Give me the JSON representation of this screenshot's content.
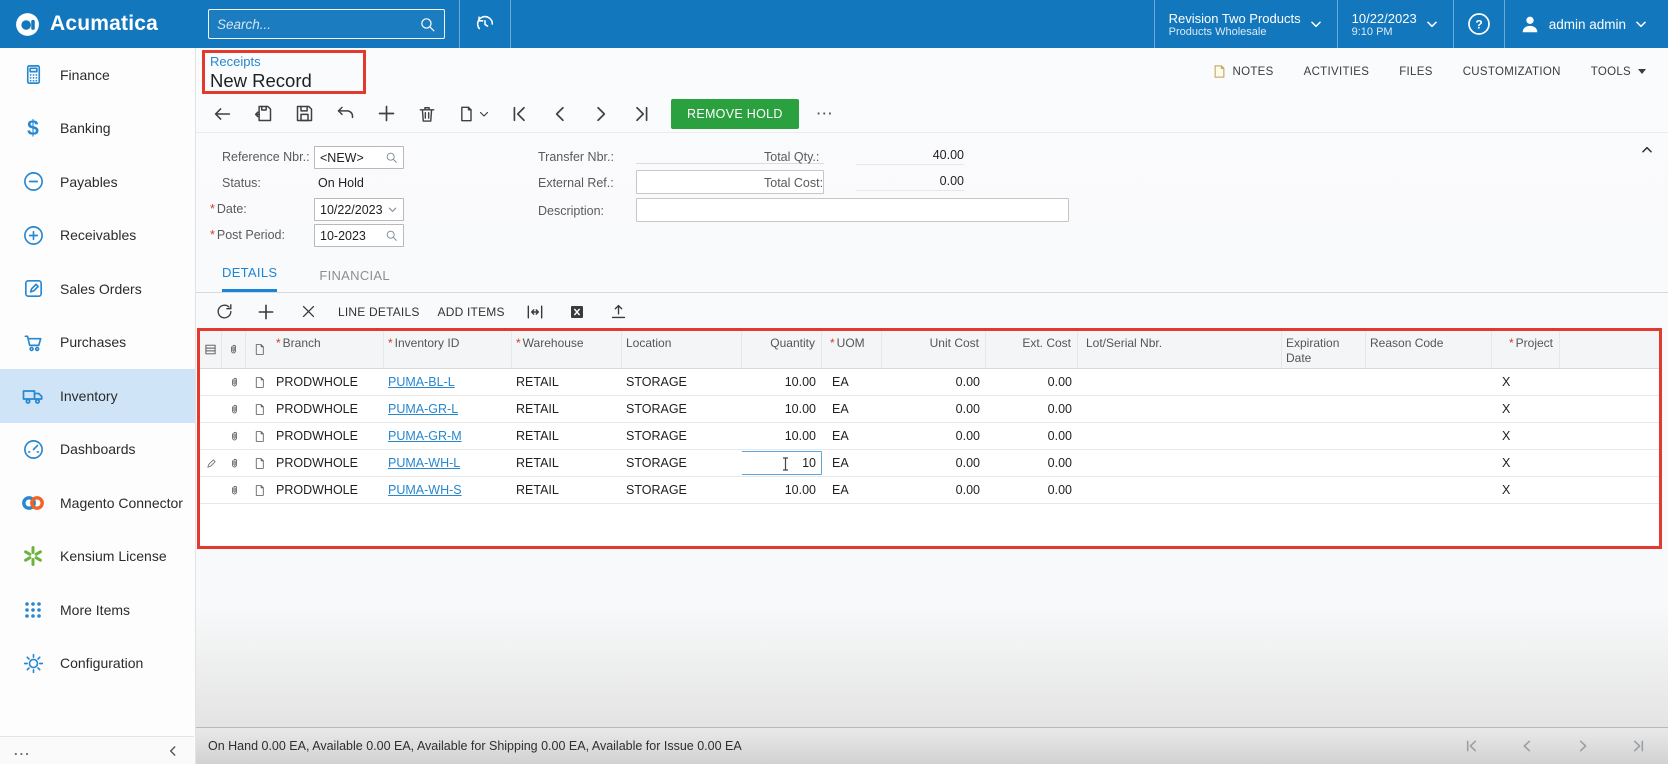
{
  "topbar": {
    "brand": "Acumatica",
    "search_placeholder": "Search...",
    "company_name": "Revision Two Products",
    "company_branch": "Products Wholesale",
    "date": "10/22/2023",
    "time": "9:10 PM",
    "user_name": "admin admin"
  },
  "header_links": {
    "notes": "NOTES",
    "activities": "ACTIVITIES",
    "files": "FILES",
    "customization": "CUSTOMIZATION",
    "tools": "TOOLS"
  },
  "breadcrumb": {
    "parent": "Receipts",
    "title": "New Record"
  },
  "toolbar": {
    "remove_hold_label": "REMOVE HOLD",
    "ellipsis": "⋯"
  },
  "sidebar": {
    "items": [
      {
        "label": "Finance"
      },
      {
        "label": "Banking"
      },
      {
        "label": "Payables"
      },
      {
        "label": "Receivables"
      },
      {
        "label": "Sales Orders"
      },
      {
        "label": "Purchases"
      },
      {
        "label": "Inventory"
      },
      {
        "label": "Dashboards"
      },
      {
        "label": "Magento Connector"
      },
      {
        "label": "Kensium License"
      },
      {
        "label": "More Items"
      },
      {
        "label": "Configuration"
      }
    ],
    "footer_dots": "...",
    "banking_glyph": "$"
  },
  "form": {
    "required_marker": "*",
    "reference_label": "Reference Nbr.:",
    "reference_value": "<NEW>",
    "status_label": "Status:",
    "status_value": "On Hold",
    "date_label": "Date:",
    "date_value": "10/22/2023",
    "post_period_label": "Post Period:",
    "post_period_value": "10-2023",
    "transfer_label": "Transfer Nbr.:",
    "external_ref_label": "External Ref.:",
    "description_label": "Description:",
    "total_qty_label": "Total Qty.:",
    "total_qty_value": "40.00",
    "total_cost_label": "Total Cost:",
    "total_cost_value": "0.00"
  },
  "tabs": {
    "details": "DETAILS",
    "financial": "FINANCIAL"
  },
  "grid_toolbar": {
    "line_details_label": "LINE DETAILS",
    "add_items_label": "ADD ITEMS"
  },
  "grid": {
    "required_marker": "*",
    "columns": {
      "branch": "Branch",
      "inventory_id": "Inventory ID",
      "warehouse": "Warehouse",
      "location": "Location",
      "quantity": "Quantity",
      "uom": "UOM",
      "unit_cost": "Unit Cost",
      "ext_cost": "Ext. Cost",
      "lot_serial": "Lot/Serial Nbr.",
      "expiration": "Expiration Date",
      "reason_code": "Reason Code",
      "project": "Project"
    },
    "rows": [
      {
        "branch": "PRODWHOLE",
        "inventory_id": "PUMA-BL-L",
        "warehouse": "RETAIL",
        "location": "STORAGE",
        "quantity": "10.00",
        "uom": "EA",
        "unit_cost": "0.00",
        "ext_cost": "0.00",
        "project": "X"
      },
      {
        "branch": "PRODWHOLE",
        "inventory_id": "PUMA-GR-L",
        "warehouse": "RETAIL",
        "location": "STORAGE",
        "quantity": "10.00",
        "uom": "EA",
        "unit_cost": "0.00",
        "ext_cost": "0.00",
        "project": "X"
      },
      {
        "branch": "PRODWHOLE",
        "inventory_id": "PUMA-GR-M",
        "warehouse": "RETAIL",
        "location": "STORAGE",
        "quantity": "10.00",
        "uom": "EA",
        "unit_cost": "0.00",
        "ext_cost": "0.00",
        "project": "X"
      },
      {
        "branch": "PRODWHOLE",
        "inventory_id": "PUMA-WH-L",
        "warehouse": "RETAIL",
        "location": "STORAGE",
        "quantity_edit": "10",
        "uom": "EA",
        "unit_cost": "0.00",
        "ext_cost": "0.00",
        "project": "X"
      },
      {
        "branch": "PRODWHOLE",
        "inventory_id": "PUMA-WH-S",
        "warehouse": "RETAIL",
        "location": "STORAGE",
        "quantity": "10.00",
        "uom": "EA",
        "unit_cost": "0.00",
        "ext_cost": "0.00",
        "project": "X"
      }
    ]
  },
  "statusbar": {
    "text": "On Hand 0.00 EA, Available 0.00 EA, Available for Shipping 0.00 EA, Available for Issue 0.00 EA"
  },
  "colors": {
    "header_blue": "#1277bd",
    "accent_blue": "#1a85d6",
    "link_blue": "#2787cf",
    "button_green": "#2aa03f",
    "annotation_red": "#e23a2e",
    "selected_item_bg": "#cfe4f6"
  }
}
